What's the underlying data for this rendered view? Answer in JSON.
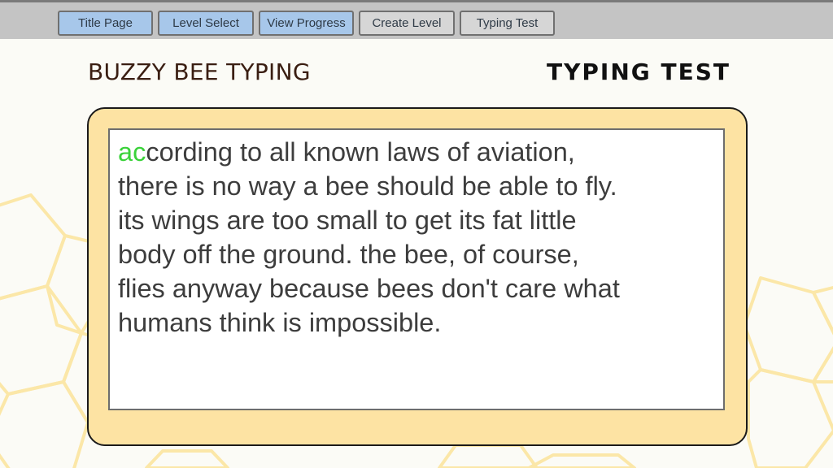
{
  "nav": {
    "buttons": [
      {
        "label": "Title Page",
        "style": "blue"
      },
      {
        "label": "Level Select",
        "style": "blue"
      },
      {
        "label": "View Progress",
        "style": "blue"
      },
      {
        "label": "Create Level",
        "style": "gray"
      },
      {
        "label": "Typing Test",
        "style": "gray"
      }
    ]
  },
  "header": {
    "app_title": "BUZZY BEE TYPING",
    "section_title": "TYPING TEST"
  },
  "typing": {
    "typed": "ac",
    "remaining": "cording to all known laws of aviation,\nthere is no way a bee should be able to fly.\nits wings are too small to get its fat little\nbody off the ground. the bee, of course,\nflies anyway because bees don't care what\nhumans think is impossible."
  },
  "colors": {
    "typed_text": "#3ad23a",
    "untyped_text": "#3d3d3d",
    "card_fill": "#fde3a3",
    "honeycomb_stroke": "#fbe7a8",
    "nav_blue": "#a7c7ea",
    "nav_gray": "#d6d6d6"
  }
}
